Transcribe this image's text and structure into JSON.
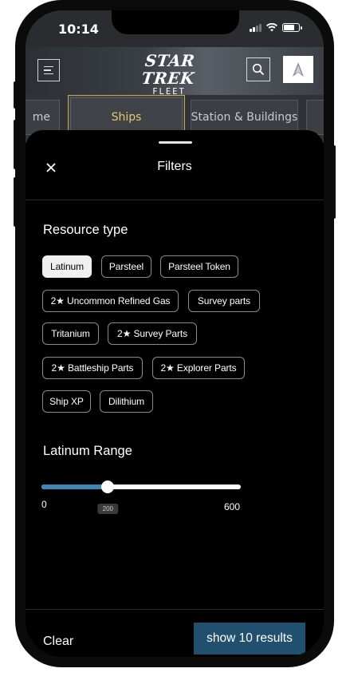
{
  "status": {
    "time": "10:14"
  },
  "header": {
    "logo_main": "STAR TREK",
    "logo_sub": "FLEET COMMAND"
  },
  "tabs": [
    {
      "label": "me",
      "active": false
    },
    {
      "label": "Ships",
      "active": true
    },
    {
      "label": "Station & Buildings",
      "active": false
    }
  ],
  "filters": {
    "title": "Filters",
    "resource_section_title": "Resource type",
    "chips": [
      {
        "label": "Latinum",
        "selected": true
      },
      {
        "label": "Parsteel",
        "selected": false
      },
      {
        "label": "Parsteel Token",
        "selected": false
      },
      {
        "label": "2★ Uncommon Refined Gas",
        "selected": false
      },
      {
        "label": "Survey parts",
        "selected": false
      },
      {
        "label": "Tritanium",
        "selected": false
      },
      {
        "label": "2★ Survey Parts",
        "selected": false
      },
      {
        "label": "2★ Battleship Parts",
        "selected": false
      },
      {
        "label": "2★ Explorer Parts",
        "selected": false
      },
      {
        "label": "Ship XP",
        "selected": false
      },
      {
        "label": "Dilithium",
        "selected": false
      }
    ],
    "range": {
      "title": "Latinum Range",
      "min_label": "0",
      "max_label": "600",
      "min": 0,
      "max": 600,
      "value": 200,
      "value_label": "200"
    },
    "clear_label": "Clear",
    "show_label": "show 10 results"
  },
  "colors": {
    "accent": "#3e88b5",
    "primary_button": "#20506e",
    "active_tab": "#e8c768"
  }
}
